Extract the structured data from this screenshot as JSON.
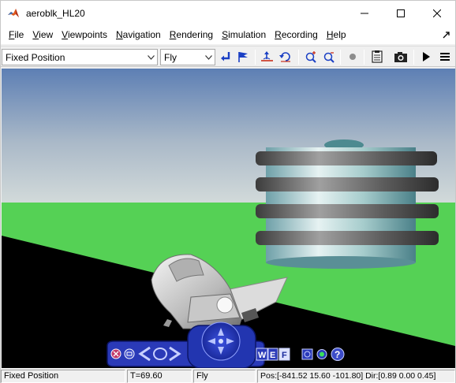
{
  "window": {
    "title": "aeroblk_HL20",
    "icon": "matlab-logo-icon"
  },
  "menu": {
    "items": [
      {
        "label": "File"
      },
      {
        "label": "View"
      },
      {
        "label": "Viewpoints"
      },
      {
        "label": "Navigation"
      },
      {
        "label": "Rendering"
      },
      {
        "label": "Simulation"
      },
      {
        "label": "Recording"
      },
      {
        "label": "Help"
      }
    ]
  },
  "toolbar": {
    "viewpoint_select": "Fixed Position",
    "navigation_select": "Fly",
    "buttons": [
      "return-to-viewpoint-icon",
      "create-viewpoint-icon",
      "straighten-up-icon",
      "undo-move-icon",
      "zoom-in-icon",
      "zoom-out-icon",
      "record-icon",
      "snapshot-icon",
      "camera-icon",
      "play-icon",
      "menu-icon"
    ]
  },
  "navpanel": {
    "labels": {
      "w": "W",
      "e": "E",
      "f": "F"
    }
  },
  "status": {
    "viewpoint": "Fixed Position",
    "time": "T=69.60",
    "mode": "Fly",
    "position": "Pos:[-841.52 15.60 -101.80] Dir:[0.89 0.00 0.45]"
  },
  "colors": {
    "sky_top": "#5d7fb4",
    "sky_bottom": "#d2dada",
    "ground": "#55d155",
    "runway": "#000000",
    "nav_panel": "#2a3ab8"
  }
}
